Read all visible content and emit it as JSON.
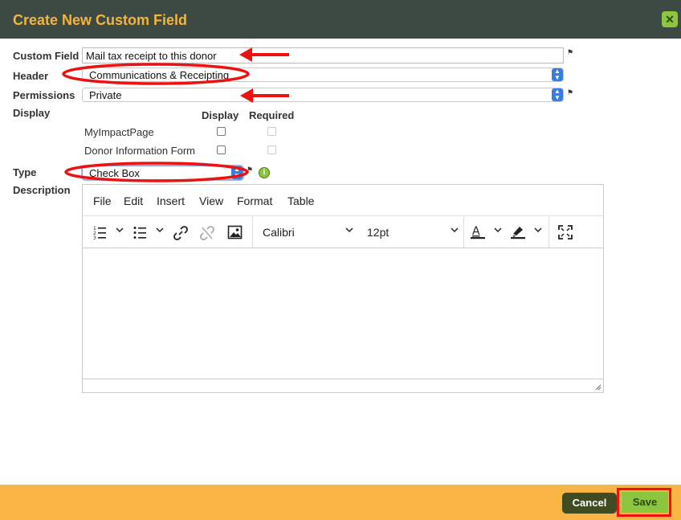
{
  "dialog": {
    "title": "Create New Custom Field",
    "close_icon": "close-icon",
    "title_color": "#f5b53c",
    "header_bg": "#3d4a43"
  },
  "form": {
    "custom_field_label": "Custom Field",
    "custom_field_value": "Mail tax receipt to this donor",
    "header_label": "Header",
    "header_value": "Communications & Receipting",
    "permissions_label": "Permissions",
    "permissions_value": "Private",
    "display_label": "Display",
    "display_col": "Display",
    "required_col": "Required",
    "display_rows": [
      {
        "label": "MyImpactPage",
        "display": false,
        "required": false
      },
      {
        "label": "Donor Information Form",
        "display": false,
        "required": false
      }
    ],
    "type_label": "Type",
    "type_value": "Check Box",
    "description_label": "Description"
  },
  "editor": {
    "menu": [
      "File",
      "Edit",
      "Insert",
      "View",
      "Format",
      "Table"
    ],
    "font": "Calibri",
    "size": "12pt",
    "icons": [
      "numbered-list-icon",
      "bullet-list-icon",
      "link-icon",
      "unlink-icon",
      "image-icon",
      "text-color-icon",
      "highlight-icon",
      "fullscreen-icon"
    ]
  },
  "footer": {
    "cancel": "Cancel",
    "save": "Save",
    "bg": "#f8b543"
  },
  "annotations": {
    "color": "#e11",
    "arrows": 3,
    "ellipses": 2
  }
}
